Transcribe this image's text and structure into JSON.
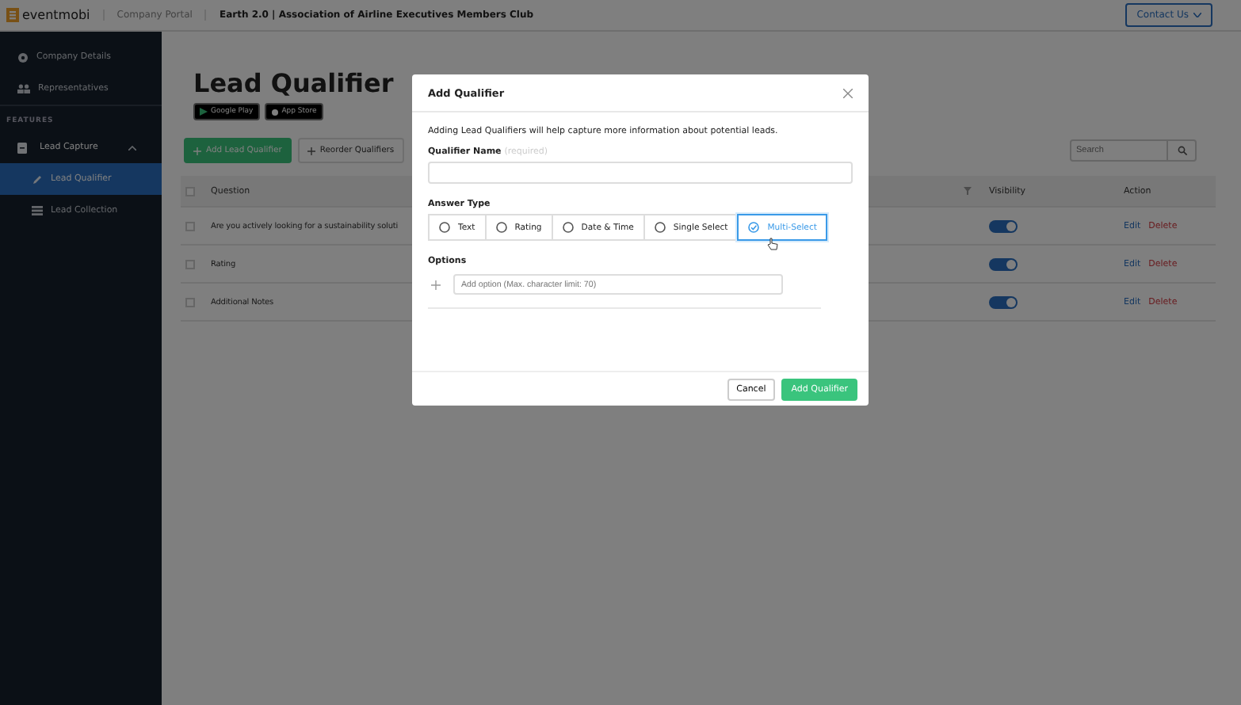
{
  "topbar": {
    "logo": "eventmobi",
    "breadcrumbs": [
      "Company Portal",
      "Earth 2.0  |  Association of Airline Executives Members Club"
    ],
    "contact_button": "Contact Us"
  },
  "sidebar": {
    "items": [
      {
        "label": "Company Details",
        "selected": false
      },
      {
        "label": "Representatives",
        "selected": false
      }
    ],
    "section": "FEATURES",
    "group": {
      "label": "Lead Capture",
      "expanded": true,
      "children": [
        {
          "label": "Lead Qualifier",
          "selected": true
        },
        {
          "label": "Lead Collection",
          "selected": false
        }
      ]
    }
  },
  "page": {
    "title": "Lead Qualifier",
    "badges": [
      "Google Play",
      "App Store"
    ],
    "add_button": "Add Lead Qualifier",
    "reorder_button": "Reorder Qualifiers",
    "search": {
      "placeholder": "Search"
    }
  },
  "table": {
    "columns": [
      "Question",
      "Visibility",
      "Action"
    ],
    "all_checked": false,
    "rows": [
      {
        "checked": false,
        "question": "Are you actively looking for a sustainability soluti",
        "visible": true,
        "edit": "Edit",
        "delete": "Delete"
      },
      {
        "checked": false,
        "question": "Rating",
        "visible": true,
        "edit": "Edit",
        "delete": "Delete"
      },
      {
        "checked": false,
        "question": "Additional Notes",
        "visible": true,
        "edit": "Edit",
        "delete": "Delete"
      }
    ]
  },
  "dialog": {
    "title": "Add Qualifier",
    "intro": "Adding Lead Qualifiers will help capture more information about potential leads.",
    "name_label": "Qualifier Name",
    "name_hint": "(required)",
    "answer_label": "Answer Type",
    "answer_types": [
      {
        "label": "Text",
        "selected": false
      },
      {
        "label": "Rating",
        "selected": false
      },
      {
        "label": "Date & Time",
        "selected": false
      },
      {
        "label": "Single Select",
        "selected": false
      },
      {
        "label": "Multi-Select",
        "selected": true
      }
    ],
    "options_label": "Options",
    "option_field": {
      "placeholder": "Add option (Max. character limit: 70)"
    },
    "cancel": "Cancel",
    "submit": "Add Qualifier"
  }
}
